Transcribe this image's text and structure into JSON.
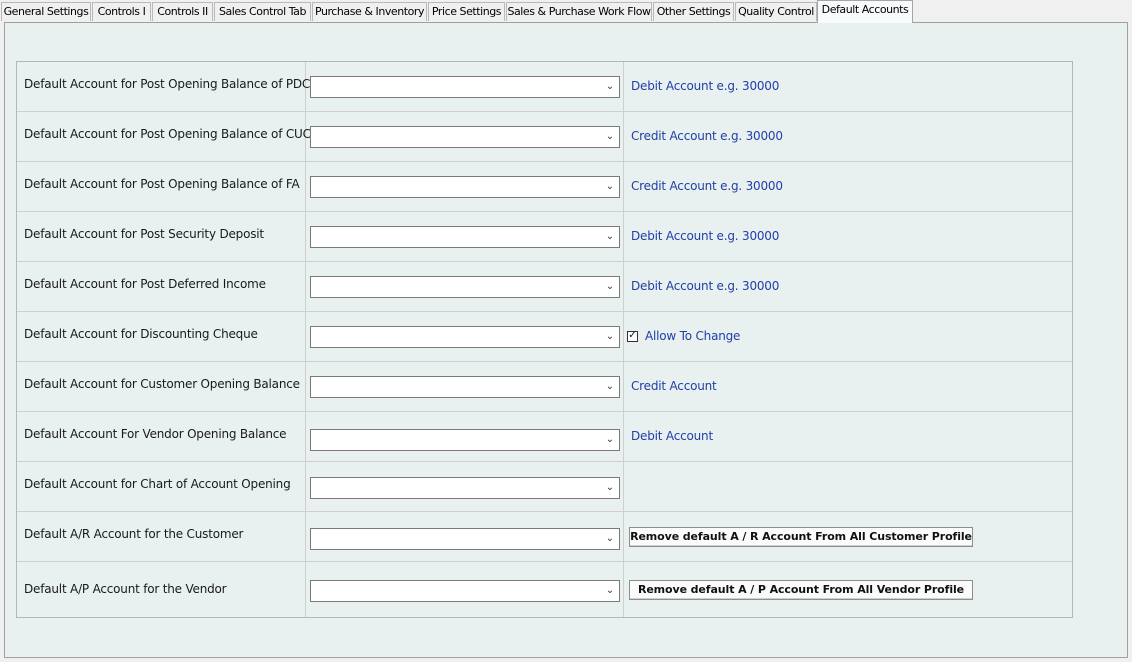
{
  "tabs": [
    {
      "label": "General Settings"
    },
    {
      "label": "Controls I"
    },
    {
      "label": "Controls II"
    },
    {
      "label": "Sales Control Tab"
    },
    {
      "label": "Purchase & Inventory"
    },
    {
      "label": "Price Settings"
    },
    {
      "label": "Sales & Purchase Work Flow"
    },
    {
      "label": "Other Settings"
    },
    {
      "label": "Quality Control"
    },
    {
      "label": "Default Accounts",
      "active": true
    }
  ],
  "rows": [
    {
      "label": "Default Account for Post Opening Balance of PDC",
      "value": "",
      "hint": "Debit Account e.g. 30000"
    },
    {
      "label": "Default Account for Post Opening Balance of CUC",
      "value": "",
      "hint": "Credit Account e.g. 30000"
    },
    {
      "label": "Default Account for Post Opening Balance of FA",
      "value": "",
      "hint": "Credit Account e.g. 30000"
    },
    {
      "label": "Default Account for Post Security Deposit",
      "value": "",
      "hint": "Debit Account e.g. 30000"
    },
    {
      "label": "Default Account for Post Deferred Income",
      "value": "",
      "hint": "Debit Account e.g. 30000"
    },
    {
      "label": "Default Account for Discounting Cheque",
      "value": "",
      "checkbox_label": "Allow To Change",
      "checked": true
    },
    {
      "label": "Default Account for Customer Opening Balance",
      "value": "",
      "hint": "Credit Account"
    },
    {
      "label": "Default Account For Vendor Opening Balance",
      "value": "",
      "hint": "Debit Account"
    },
    {
      "label": "Default Account for Chart of Account Opening",
      "value": ""
    },
    {
      "label": "Default A/R Account for the Customer",
      "value": "",
      "button": "Remove default A / R Account From All Customer Profile"
    },
    {
      "label": "Default A/P Account for the Vendor",
      "value": "",
      "button": "Remove default A / P Account From All Vendor Profile"
    }
  ],
  "icons": {
    "dropdown": "chevron-down-icon",
    "check": "checkmark-icon"
  },
  "colors": {
    "hint_text": "#1f3fa8",
    "panel_bg": "#e9f0f0"
  }
}
